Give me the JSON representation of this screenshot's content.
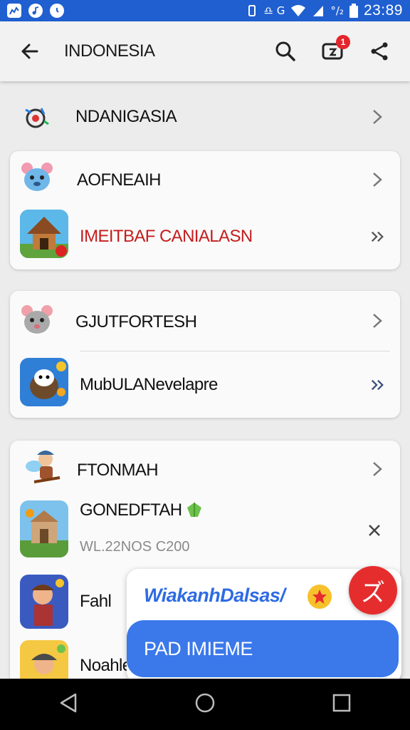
{
  "status_bar": {
    "left_icons": [
      "chart-icon",
      "music-icon",
      "clock-icon"
    ],
    "signal_text": "♎ G",
    "battery_text": "°/₂",
    "time": "23:89"
  },
  "app_bar": {
    "title": "INDONESIA",
    "notification_count": "1"
  },
  "sections": {
    "top_item": {
      "label": "NDANIGASIA"
    },
    "card1": {
      "items": [
        {
          "label": "AOFNEAIH"
        },
        {
          "label": "IMEITBAF CANIALASN",
          "color": "#c41d1d"
        }
      ]
    },
    "card2": {
      "items": [
        {
          "label": "GJUTFORTESH"
        },
        {
          "label": "MubULANevelapre"
        }
      ]
    },
    "card3": {
      "items": [
        {
          "label": "FTONMAH"
        },
        {
          "label": "GONEDFTAH",
          "subtitle": "WL.22NOS C200"
        },
        {
          "label": "Fahl"
        },
        {
          "label": "Noahle"
        }
      ]
    }
  },
  "popup": {
    "text": "WiakanhDalsas/",
    "button_label": "PAD IMIEME",
    "close_glyph": "ズ"
  },
  "colors": {
    "accent": "#3b78ea",
    "status_bar": "#1f5fd0",
    "danger": "#e52d2d"
  }
}
